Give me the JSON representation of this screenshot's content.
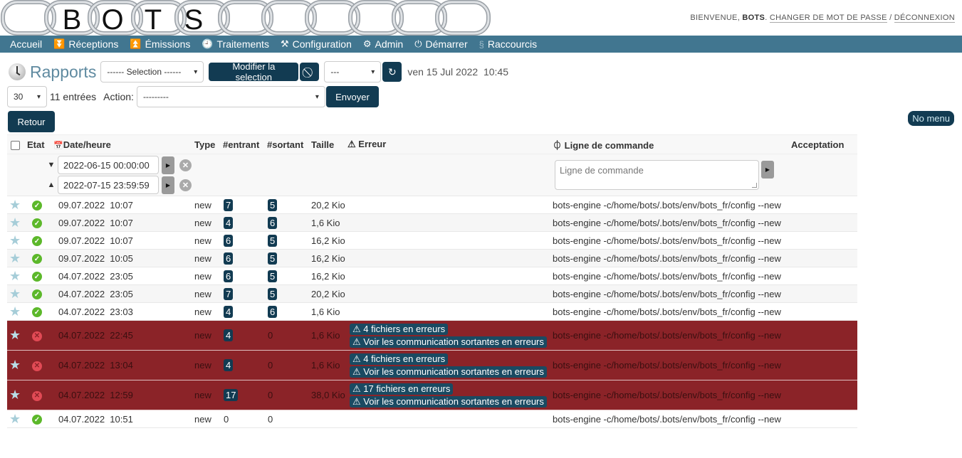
{
  "header": {
    "logo_text": "BOTS",
    "logo_letters": [
      "B",
      "O",
      "T",
      "S"
    ],
    "welcome_prefix": "BIENVENUE,",
    "username": "BOTS",
    "change_password": "CHANGER DE MOT DE PASSE",
    "separator": "/",
    "logout": "DÉCONNEXION"
  },
  "nav": {
    "items": [
      {
        "label": "Accueil",
        "icon": ""
      },
      {
        "label": "Réceptions",
        "icon": "reception-icon"
      },
      {
        "label": "Émissions",
        "icon": "emission-icon"
      },
      {
        "label": "Traitements",
        "icon": "clock-icon"
      },
      {
        "label": "Configuration",
        "icon": "tools-icon"
      },
      {
        "label": "Admin",
        "icon": "gear-icon"
      },
      {
        "label": "Démarrer",
        "icon": "power-icon"
      },
      {
        "label": "Raccourcis",
        "icon": "link-icon"
      }
    ]
  },
  "toolbar": {
    "title": "Rapports",
    "selection_select": "------ Selection ------",
    "modify_selection": "Modifier la selection",
    "period_select": "---",
    "timestamp": "ven 15 Jul 2022  10:45",
    "page_size": "30",
    "entries": "11 entrées",
    "action_label": "Action:",
    "action_select": "---------",
    "send": "Envoyer",
    "back": "Retour",
    "no_menu": "No menu"
  },
  "table": {
    "headers": {
      "etat": "Etat",
      "datetime": "Date/heure",
      "type": "Type",
      "incoming": "#entrant",
      "outgoing": "#sortant",
      "size": "Taille",
      "error": "Erreur",
      "command": "Ligne de commande",
      "acceptance": "Acceptation"
    },
    "filters": {
      "date_from": "2022-06-15 00:00:00",
      "date_to": "2022-07-15 23:59:59",
      "command_placeholder": "Ligne de commande"
    },
    "rows": [
      {
        "status": "ok",
        "date": "09.07.2022  10:07",
        "type": "new",
        "in": "7",
        "out": "5",
        "size": "20,2 Kio",
        "errors": [],
        "command": "bots-engine -c/home/bots/.bots/env/bots_fr/config --new"
      },
      {
        "status": "ok",
        "date": "09.07.2022  10:07",
        "type": "new",
        "in": "4",
        "out": "6",
        "size": "1,6 Kio",
        "errors": [],
        "command": "bots-engine -c/home/bots/.bots/env/bots_fr/config --new"
      },
      {
        "status": "ok",
        "date": "09.07.2022  10:07",
        "type": "new",
        "in": "6",
        "out": "5",
        "size": "16,2 Kio",
        "errors": [],
        "command": "bots-engine -c/home/bots/.bots/env/bots_fr/config --new"
      },
      {
        "status": "ok",
        "date": "09.07.2022  10:05",
        "type": "new",
        "in": "6",
        "out": "5",
        "size": "16,2 Kio",
        "errors": [],
        "command": "bots-engine -c/home/bots/.bots/env/bots_fr/config --new"
      },
      {
        "status": "ok",
        "date": "04.07.2022  23:05",
        "type": "new",
        "in": "6",
        "out": "5",
        "size": "16,2 Kio",
        "errors": [],
        "command": "bots-engine -c/home/bots/.bots/env/bots_fr/config --new"
      },
      {
        "status": "ok",
        "date": "04.07.2022  23:05",
        "type": "new",
        "in": "7",
        "out": "5",
        "size": "20,2 Kio",
        "errors": [],
        "command": "bots-engine -c/home/bots/.bots/env/bots_fr/config --new"
      },
      {
        "status": "ok",
        "date": "04.07.2022  23:03",
        "type": "new",
        "in": "4",
        "out": "6",
        "size": "1,6 Kio",
        "errors": [],
        "command": "bots-engine -c/home/bots/.bots/env/bots_fr/config --new"
      },
      {
        "status": "error",
        "date": "04.07.2022  22:45",
        "type": "new",
        "in": "4",
        "out": "0",
        "size": "1,6 Kio",
        "errors": [
          "⚠ 4 fichiers en erreurs",
          "⚠ Voir les communication sortantes en erreurs"
        ],
        "command": "bots-engine -c/home/bots/.bots/env/bots_fr/config --new"
      },
      {
        "status": "error",
        "date": "04.07.2022  13:04",
        "type": "new",
        "in": "4",
        "out": "0",
        "size": "1,6 Kio",
        "errors": [
          "⚠ 4 fichiers en erreurs",
          "⚠ Voir les communication sortantes en erreurs"
        ],
        "command": "bots-engine -c/home/bots/.bots/env/bots_fr/config --new"
      },
      {
        "status": "error",
        "date": "04.07.2022  12:59",
        "type": "new",
        "in": "17",
        "out": "0",
        "size": "38,0 Kio",
        "errors": [
          "⚠ 17 fichiers en erreurs",
          "⚠ Voir les communication sortantes en erreurs"
        ],
        "command": "bots-engine -c/home/bots/.bots/env/bots_fr/config --new"
      },
      {
        "status": "ok",
        "date": "04.07.2022  10:51",
        "type": "new",
        "in": "0",
        "out": "0",
        "size": "",
        "errors": [],
        "command": "bots-engine -c/home/bots/.bots/env/bots_fr/config --new"
      }
    ]
  },
  "colors": {
    "navbar": "#417690",
    "button": "#123b52",
    "error_row": "#8b2328",
    "ok": "#5cb82a",
    "title": "#5f8aa0"
  }
}
